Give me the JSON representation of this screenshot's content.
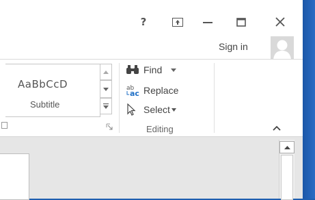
{
  "window": {
    "help_label": "?",
    "ribbon_display_label": "↥",
    "minimize_label": "—",
    "maximize_label": "☐",
    "close_label": "✕"
  },
  "account": {
    "signin_label": "Sign in"
  },
  "styles": {
    "sample_text": "AaBbCcD",
    "name": "Subtitle"
  },
  "editing": {
    "find_label": "Find",
    "replace_label": "Replace",
    "select_label": "Select",
    "group_label": "Editing"
  },
  "icons": {
    "find": "binoculars-icon",
    "replace": "ab-ac-replace-icon",
    "select": "cursor-arrow-icon"
  }
}
